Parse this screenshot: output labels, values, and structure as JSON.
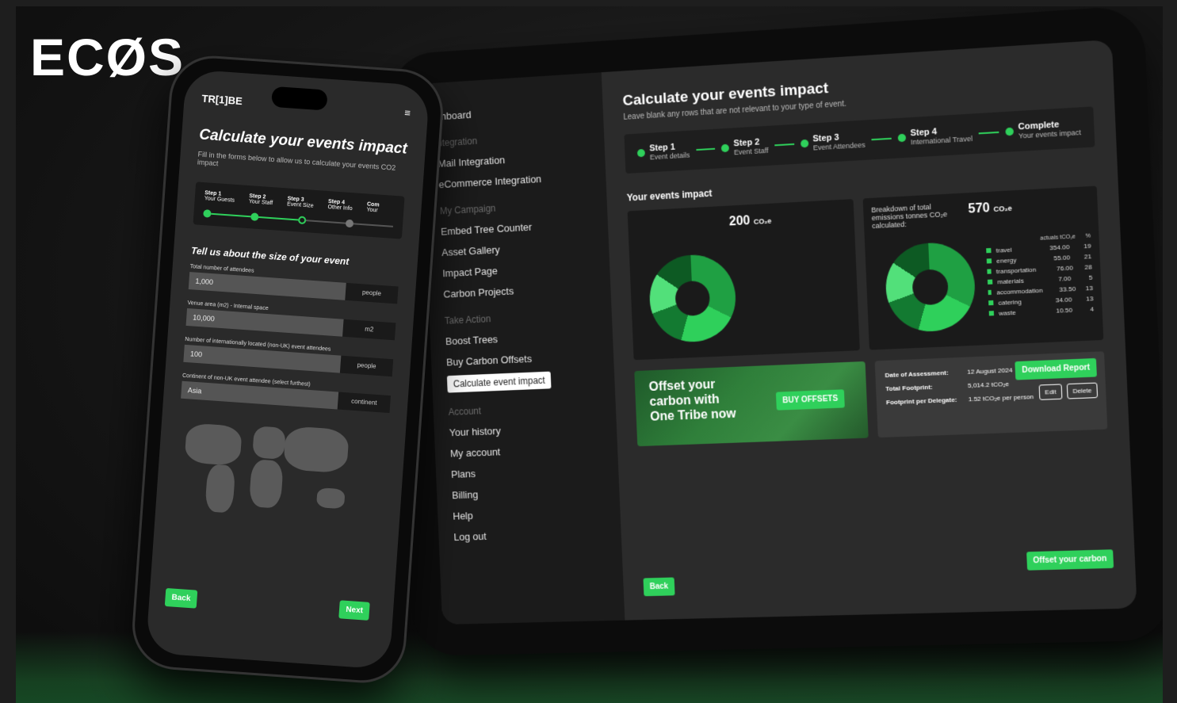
{
  "brand": "ECØS",
  "tablet": {
    "sidebar": {
      "items_top": [
        "shboard"
      ],
      "section_integration": "ntegration",
      "integration_items": [
        "Mail Integration",
        "eCommerce Integration"
      ],
      "section_campaign": "My Campaign",
      "campaign_items": [
        "Embed Tree Counter",
        "Asset Gallery",
        "Impact Page",
        "Carbon Projects"
      ],
      "section_action": "Take Action",
      "action_items": [
        "Boost Trees",
        "Buy Carbon Offsets"
      ],
      "active_item": "Calculate event impact",
      "section_account": "Account",
      "account_items": [
        "Your history",
        "My account",
        "Plans",
        "Billing",
        "Help",
        "Log out"
      ]
    },
    "title": "Calculate your events impact",
    "subtitle": "Leave blank any rows that are not relevant to your type of event.",
    "steps": [
      {
        "label": "Step 1",
        "sub": "Event details"
      },
      {
        "label": "Step 2",
        "sub": "Event Staff"
      },
      {
        "label": "Step 3",
        "sub": "Event Attendees"
      },
      {
        "label": "Step 4",
        "sub": "International Travel"
      },
      {
        "label": "Complete",
        "sub": "Your events impact"
      }
    ],
    "impact_heading": "Your events impact",
    "card1": {
      "total": "200",
      "unit": "CO₂e"
    },
    "card2": {
      "title": "Breakdown of total emissions tonnes CO₂e calculated:",
      "total": "570",
      "unit": "CO₂e",
      "col_a": "actuals tCO₂e",
      "col_b": "%",
      "rows": [
        {
          "name": "travel",
          "value": "354.00",
          "pct": "19"
        },
        {
          "name": "energy",
          "value": "55.00",
          "pct": "21"
        },
        {
          "name": "transportation",
          "value": "76.00",
          "pct": "28"
        },
        {
          "name": "materials",
          "value": "7.00",
          "pct": "5"
        },
        {
          "name": "accommodation",
          "value": "33.50",
          "pct": "13"
        },
        {
          "name": "catering",
          "value": "34.00",
          "pct": "13"
        },
        {
          "name": "waste",
          "value": "10.50",
          "pct": "4"
        }
      ]
    },
    "promo": {
      "text": "Offset your carbon with One Tribe now",
      "button": "BUY OFFSETS"
    },
    "info": {
      "date_label": "Date of Assessment:",
      "date_value": "12 August 2024",
      "footprint_label": "Total Footprint:",
      "footprint_value": "5,014.2 tCO₂e",
      "delegate_label": "Footprint per Delegate:",
      "delegate_value": "1.52 tCO₂e per person",
      "download": "Download Report",
      "edit": "Edit",
      "delete": "Delete"
    },
    "back": "Back",
    "offset": "Offset your carbon"
  },
  "phone": {
    "logo": "TR[1]BE",
    "menu_icon": "hamburger-icon",
    "title": "Calculate your events impact",
    "subtitle": "Fill in the forms below to allow us to calculate your events CO2 impact",
    "steps": [
      {
        "label": "Step 1",
        "sub": "Your Guests"
      },
      {
        "label": "Step 2",
        "sub": "Your Staff"
      },
      {
        "label": "Step 3",
        "sub": "Event Size"
      },
      {
        "label": "Step 4",
        "sub": "Other Info"
      },
      {
        "label": "Com",
        "sub": "Your"
      }
    ],
    "section": "Tell us about the size of your event",
    "fields": [
      {
        "label": "Total number of attendees",
        "value": "1,000",
        "unit": "people"
      },
      {
        "label": "Venue area (m2) - Internal space",
        "value": "10,000",
        "unit": "m2"
      },
      {
        "label": "Number of internationally located (non-UK) event attendees",
        "value": "100",
        "unit": "people"
      },
      {
        "label": "Continent of non-UK event attendee (select furthest)",
        "value": "Asia",
        "unit": "continent"
      }
    ],
    "back": "Back",
    "next": "Next"
  },
  "colors": {
    "accent": "#2fd05b",
    "background": "#161616"
  }
}
